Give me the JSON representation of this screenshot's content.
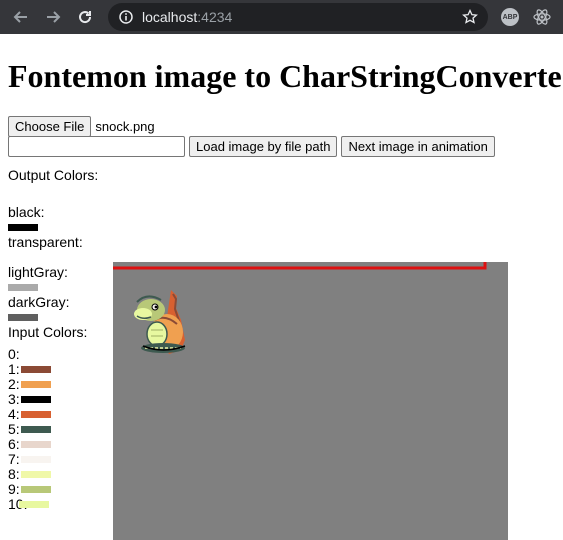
{
  "browser": {
    "url_host": "localhost",
    "url_port": ":4234",
    "extension_abp": "ABP"
  },
  "page": {
    "title": "Fontemon image to CharStringConverte",
    "choose_file_label": "Choose File",
    "file_name": "snock.png",
    "path_input_value": "",
    "load_button_label": "Load image by file path",
    "next_button_label": "Next image in animation",
    "output_colors_heading": "Output Colors:",
    "output_colors": [
      {
        "name": "black:",
        "color": "#000000"
      },
      {
        "name": "transparent:",
        "color": "transparent"
      },
      {
        "name": "lightGray:",
        "color": "#aaaaaa"
      },
      {
        "name": "darkGray:",
        "color": "#5f5f5f"
      }
    ],
    "input_colors_heading": "Input Colors:",
    "input_colors": [
      {
        "index": "0:",
        "color": ""
      },
      {
        "index": "1:",
        "color": "#8b4a35"
      },
      {
        "index": "2:",
        "color": "#f0a050"
      },
      {
        "index": "3:",
        "color": "#000000"
      },
      {
        "index": "4:",
        "color": "#d86030"
      },
      {
        "index": "5:",
        "color": "#3e5a50"
      },
      {
        "index": "6:",
        "color": "#e8d6cc"
      },
      {
        "index": "7:",
        "color": "#f8f4f0"
      },
      {
        "index": "8:",
        "color": "#f0f8a8"
      },
      {
        "index": "9:",
        "color": "#b8c878"
      },
      {
        "index": "10:",
        "color": "#e8f8a0"
      }
    ],
    "canvas_background": "#808080",
    "outline_color": "#dd1111"
  }
}
